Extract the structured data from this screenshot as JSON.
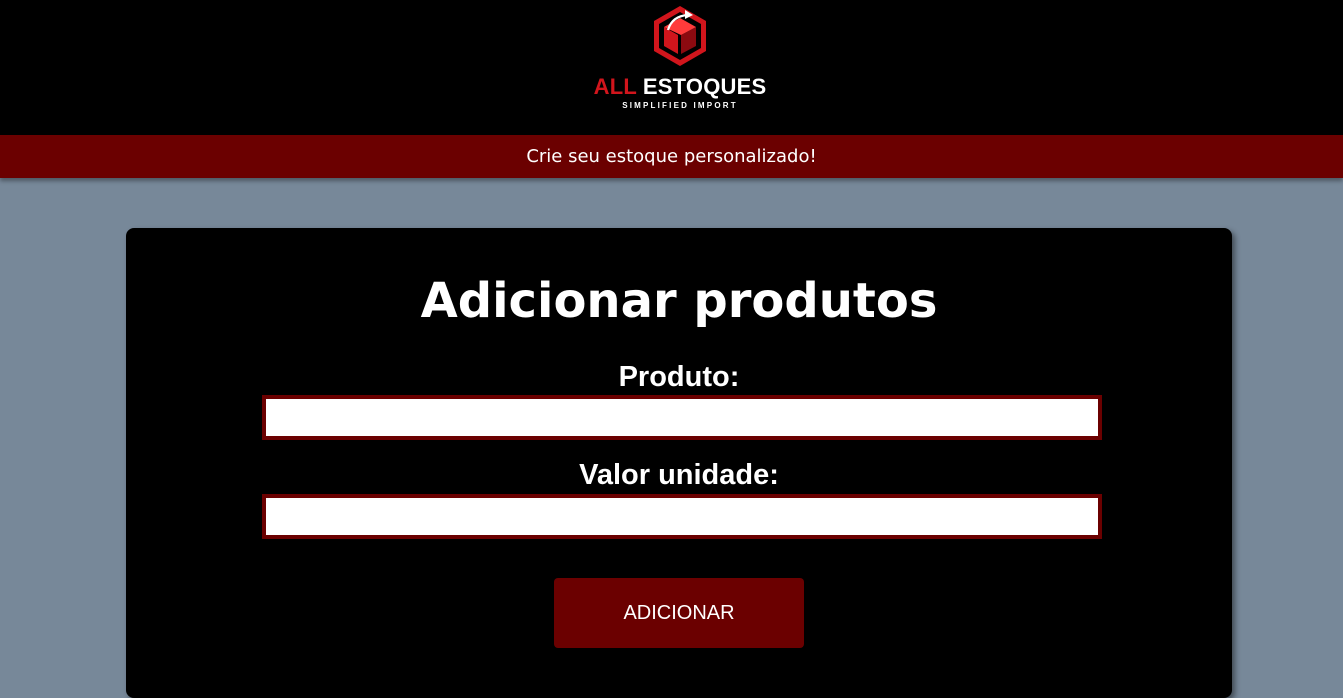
{
  "header": {
    "logo": {
      "brand_first": "ALL",
      "brand_second": "ESTOQUES",
      "tagline": "SIMPLIFIED IMPORT",
      "icon": "cube-arrow-logo-icon",
      "colors": {
        "accent": "#d1151c",
        "text": "#ffffff"
      }
    }
  },
  "banner": {
    "text": "Crie seu estoque personalizado!"
  },
  "form": {
    "title": "Adicionar produtos",
    "fields": [
      {
        "label": "Produto:",
        "value": "",
        "placeholder": ""
      },
      {
        "label": "Valor unidade:",
        "value": "",
        "placeholder": ""
      }
    ],
    "submit_label": "ADICIONAR"
  },
  "colors": {
    "page_background": "#778899",
    "header_background": "#000000",
    "brand_dark_red": "#6b0000",
    "card_background": "#000000"
  }
}
